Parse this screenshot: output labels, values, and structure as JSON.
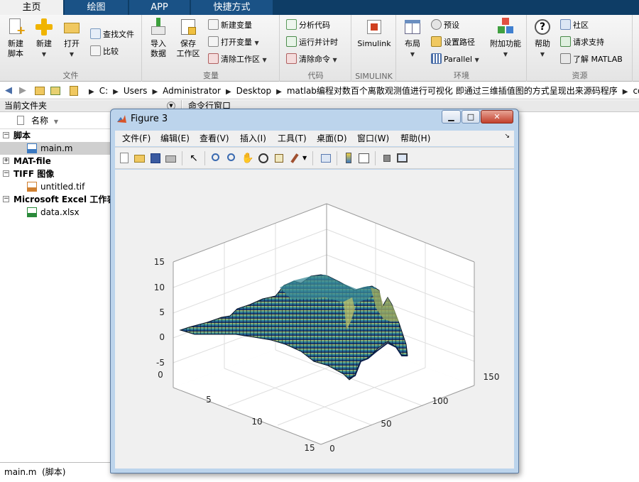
{
  "tabs": [
    {
      "label": "主页",
      "active": true
    },
    {
      "label": "绘图",
      "active": false
    },
    {
      "label": "APP",
      "active": false
    },
    {
      "label": "快捷方式",
      "active": false
    }
  ],
  "toolstrip": {
    "file": {
      "label": "文件",
      "new_script": "新建\n脚本",
      "new": "新建",
      "open": "打开",
      "find_files": "查找文件",
      "compare": "比较"
    },
    "variable": {
      "label": "变量",
      "import_data": "导入\n数据",
      "save_workspace": "保存\n工作区",
      "new_variable": "新建变量",
      "open_variable": "打开变量",
      "clear_workspace": "清除工作区"
    },
    "code": {
      "label": "代码",
      "analyze_code": "分析代码",
      "run_and_time": "运行并计时",
      "clear_commands": "清除命令"
    },
    "simulink": {
      "label": "SIMULINK",
      "button": "Simulink"
    },
    "environment": {
      "label": "环境",
      "layout": "布局",
      "preferences": "预设",
      "set_path": "设置路径",
      "parallel": "Parallel",
      "addons": "附加功能"
    },
    "resources": {
      "label": "资源",
      "help": "帮助",
      "community": "社区",
      "request_support": "请求支持",
      "learn_matlab": "了解 MATLAB"
    }
  },
  "address": {
    "crumbs": [
      "C:",
      "Users",
      "Administrator",
      "Desktop",
      "matlab编程对数百个离散观测值进行可视化 即通过三维插值图的方式呈现出来源码程序",
      "coc"
    ]
  },
  "current_folder": {
    "title": "当前文件夹",
    "column_name": "名称",
    "groups": [
      {
        "name": "脚本",
        "files": [
          {
            "name": "main.m",
            "selected": true
          }
        ]
      },
      {
        "name": "MAT-file",
        "files": []
      },
      {
        "name": "TIFF 图像",
        "files": [
          {
            "name": "untitled.tif",
            "selected": false
          }
        ]
      },
      {
        "name": "Microsoft Excel 工作表",
        "files": [
          {
            "name": "data.xlsx",
            "selected": false
          }
        ]
      }
    ],
    "details": "main.m  (脚本)"
  },
  "command_window": {
    "title": "命令行窗口"
  },
  "figure": {
    "title": "Figure 3",
    "menu": [
      "文件(F)",
      "编辑(E)",
      "查看(V)",
      "插入(I)",
      "工具(T)",
      "桌面(D)",
      "窗口(W)",
      "帮助(H)"
    ],
    "axes": {
      "z_ticks": [
        "15",
        "10",
        "5",
        "0",
        "-5"
      ],
      "y_ticks": [
        "0",
        "5",
        "10",
        "15"
      ],
      "x_ticks": [
        "0",
        "50",
        "100",
        "150"
      ]
    }
  },
  "colors": {
    "tab_bg": "#0e3d66",
    "accent_blue": "#1a5286",
    "surface_dark": "#0b1f4a",
    "surface_light": "#4fb0a0",
    "surface_peak": "#d8c870"
  }
}
